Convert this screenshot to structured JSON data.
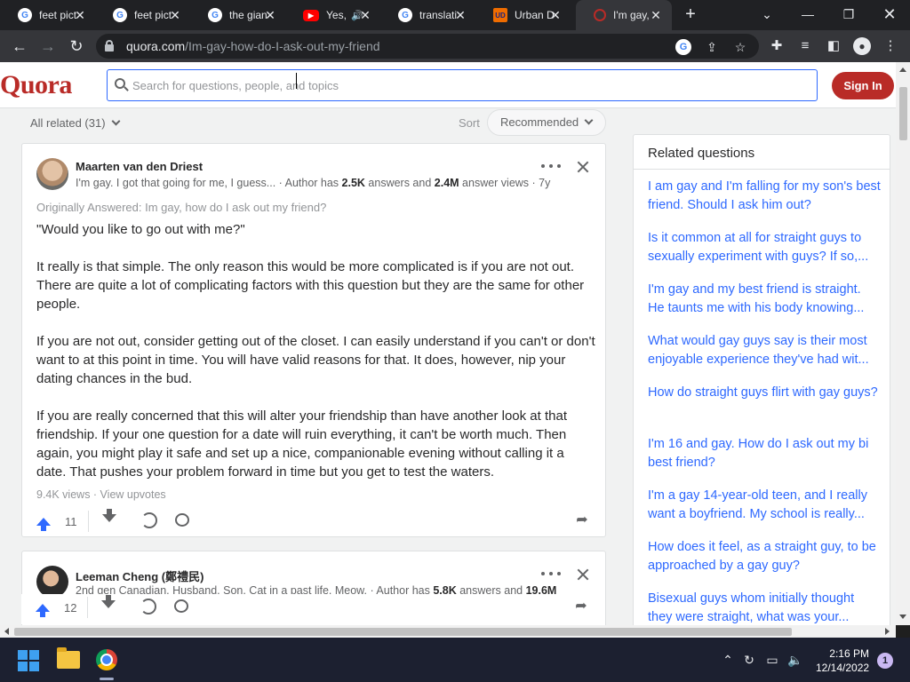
{
  "browser": {
    "tabs": [
      {
        "title": "feet pict",
        "favicon": "google-icon"
      },
      {
        "title": "feet pict",
        "favicon": "google-icon"
      },
      {
        "title": "the gian",
        "favicon": "google-icon"
      },
      {
        "title": "Yes,",
        "favicon": "youtube-icon"
      },
      {
        "title": "translati",
        "favicon": "google-icon"
      },
      {
        "title": "Urban D",
        "favicon": "urban-dictionary-icon"
      },
      {
        "title": "I'm gay,",
        "favicon": "quora-icon",
        "active": true
      }
    ],
    "url_domain": "quora.com",
    "url_path": "/Im-gay-how-do-I-ask-out-my-friend"
  },
  "quora": {
    "logo": "Quora",
    "search_placeholder": "Search for questions, people, and topics",
    "signin_label": "Sign In",
    "all_related": "All related (31)",
    "sort_label": "Sort",
    "sort_value": "Recommended"
  },
  "answer1": {
    "author": "Maarten van den Driest",
    "credential_prefix": "I'm gay. I got that going for me, I guess... · Author has ",
    "answers_count": "2.5K",
    "answers_mid": " answers and ",
    "views_count": "2.4M",
    "views_suffix": " answer views · 7y",
    "originally": "Originally Answered: Im gay, how do I ask out my friend?",
    "paragraphs": [
      "\"Would you like to go out with me?\"",
      "It really is that simple. The only reason this would be more complicated is if you are not out. There are quite a lot of complicating factors with this question but they are the same for other people.",
      "If you are not out, consider getting out of the closet. I can easily understand if you can't or don't want to at this point in time. You will have valid reasons for that. It does, however, nip your dating chances in the bud.",
      "If you are really concerned that this will alter your friendship than have another look at that friendship. If your one question for a date will ruin everything, it can't be worth much. Then again, you might play it safe and set up a nice, companionable evening without calling it a date. That pushes your problem forward in time but you get to test the waters."
    ],
    "meta": "9.4K views · View upvotes",
    "upvotes": "11"
  },
  "answer2": {
    "author": "Leeman Cheng (鄭禮民)",
    "credential_prefix": "2nd gen Canadian, Husband, Son, Cat in a past life. Meow. · Author has ",
    "answers_count": "5.8K",
    "answers_mid": " answers and ",
    "views_count": "19.6M",
    "upvotes": "12"
  },
  "related": {
    "title": "Related questions",
    "items": [
      "I am gay and I'm falling for my son's best friend. Should I ask him out?",
      "Is it common at all for straight guys to sexually experiment with guys? If so,...",
      "I'm gay and my best friend is straight. He taunts me with his body knowing...",
      "What would gay guys say is their most enjoyable experience they've had wit...",
      "How do straight guys flirt with gay guys?",
      "I'm 16 and gay. How do I ask out my bi best friend?",
      "I'm a gay 14-year-old teen, and I really want a boyfriend. My school is really...",
      "How does it feel, as a straight guy, to be approached by a gay guy?",
      "Bisexual guys whom initially thought they were straight, what was your..."
    ]
  },
  "taskbar": {
    "time": "2:16 PM",
    "date": "12/14/2022",
    "notifications": "1"
  },
  "colors": {
    "quora_red": "#b92b27",
    "link_blue": "#2e69ff",
    "chrome_dark": "#202124"
  }
}
